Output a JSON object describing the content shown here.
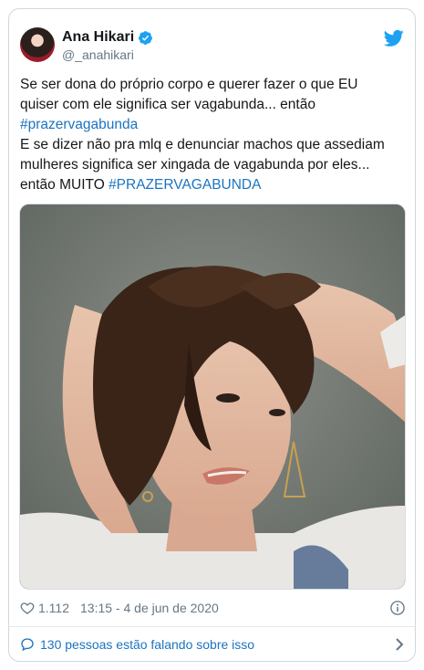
{
  "author": {
    "display_name": "Ana Hikari",
    "handle": "@_anahikari"
  },
  "tweet": {
    "segments": [
      {
        "line": 1,
        "text": "Se ser dona do próprio corpo e querer fazer o que EU"
      },
      {
        "line": 2,
        "text": "quiser com ele significa ser vagabunda... então"
      },
      {
        "line": 3,
        "text": "#prazervagabunda"
      },
      {
        "line": 4,
        "text": "E se dizer não pra mlq e denunciar machos que assediam"
      },
      {
        "line": 5,
        "text": "mulheres significa ser xingada de vagabunda por eles..."
      },
      {
        "line": 6,
        "prefix": "então MUITO ",
        "hashtag": "#PRAZERVAGABUNDA"
      }
    ]
  },
  "meta": {
    "likes": "1.112",
    "timestamp": "13:15 - 4 de jun de 2020"
  },
  "conversation": {
    "label": "130 pessoas estão falando sobre isso"
  },
  "colors": {
    "link": "#1b74c1",
    "twitter_blue": "#1da1f2",
    "text": "#14171a",
    "muted": "#657786"
  },
  "icons": [
    "verified-badge-icon",
    "twitter-bird-icon",
    "heart-icon",
    "info-icon",
    "speech-bubble-icon",
    "chevron-right-icon"
  ]
}
